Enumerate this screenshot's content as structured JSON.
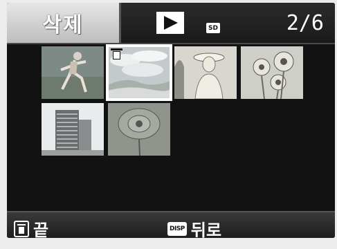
{
  "header": {
    "delete_label": "삭제",
    "play_icon": "play-mode-icon",
    "media_icon": "sd-card-icon",
    "media_label": "SD",
    "counter": "2/6"
  },
  "thumbnails": [
    {
      "name": "thumb-running-woman",
      "selected": false
    },
    {
      "name": "thumb-clouds-landscape",
      "selected": true,
      "marked_for_delete": true
    },
    {
      "name": "thumb-woman-with-hat",
      "selected": false
    },
    {
      "name": "thumb-flowers-sketch",
      "selected": false
    },
    {
      "name": "thumb-building",
      "selected": false
    },
    {
      "name": "thumb-single-flower",
      "selected": false
    }
  ],
  "footer": {
    "end_key_icon": "trash-key-icon",
    "end_label": "끝",
    "back_key_label": "DISP",
    "back_label": "뒤로"
  },
  "colors": {
    "screen_bg": "#121212",
    "tab_bg": "#d0d0d0",
    "selection": "#ffffff"
  }
}
